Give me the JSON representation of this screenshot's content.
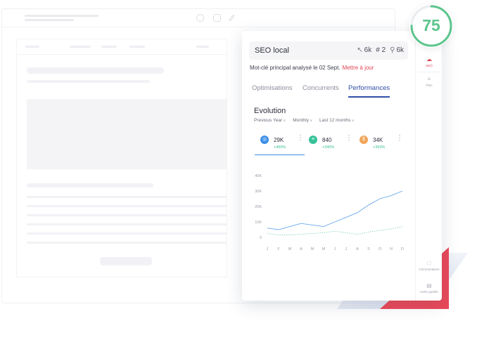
{
  "score": {
    "value": "75",
    "color": "#5cc58c",
    "fraction": 0.75
  },
  "keyword": {
    "label": "SEO local",
    "volume": "6k",
    "position": "# 2",
    "results": "6k"
  },
  "analysis": {
    "text": "Mot-clé principal analysé le 02 Sept.",
    "update_link": "Mettre à jour"
  },
  "tabs": [
    {
      "label": "Optimisations",
      "active": false
    },
    {
      "label": "Concurrents",
      "active": false
    },
    {
      "label": "Performances",
      "active": true
    }
  ],
  "evolution": {
    "title": "Evolution",
    "filters": [
      "Previous Year",
      "Monthly",
      "Last 12 months"
    ]
  },
  "metrics": [
    {
      "icon": "traffic-icon",
      "value": "29K",
      "delta": "+460%",
      "color": "#3b8fe8"
    },
    {
      "icon": "list-icon",
      "value": "840",
      "delta": "+340%",
      "color": "#37c29a"
    },
    {
      "icon": "dollar-icon",
      "value": "34K",
      "delta": "+393%",
      "color": "#f0a55a"
    }
  ],
  "chart_data": {
    "type": "line",
    "categories": [
      "J",
      "F",
      "M",
      "A",
      "M",
      "M",
      "J",
      "J",
      "A",
      "S",
      "O",
      "N",
      "D"
    ],
    "y_ticks": [
      "40K",
      "30K",
      "20K",
      "10K",
      "0"
    ],
    "ylim": [
      0,
      40000
    ],
    "grid": false,
    "series": [
      {
        "style": "solid",
        "color": "#6aa8ef",
        "values": [
          6000,
          5000,
          7000,
          9000,
          8000,
          7000,
          10000,
          13000,
          16000,
          21000,
          25000,
          27000,
          30000
        ]
      },
      {
        "style": "dotted",
        "color": "#7fd0b4",
        "values": [
          2500,
          1500,
          1500,
          2000,
          2500,
          3000,
          4000,
          3000,
          2000,
          3500,
          4500,
          5500,
          7000
        ]
      }
    ]
  },
  "rail": {
    "seo": "SEO",
    "plan": "Plan",
    "comments": "Commentaires",
    "guide": "Invite guidée"
  }
}
